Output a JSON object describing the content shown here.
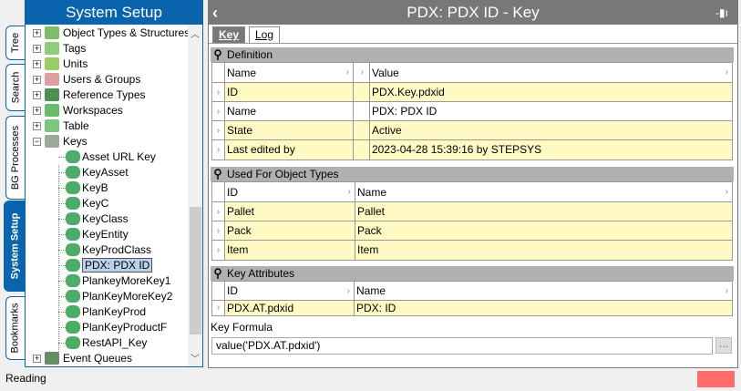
{
  "vertical_tabs": [
    "Tree",
    "Search",
    "BG Processes",
    "System Setup",
    "Bookmarks"
  ],
  "left_panel": {
    "title": "System Setup",
    "tree": [
      {
        "label": "Object Types & Structures",
        "level": 0,
        "expander": "+",
        "icon": "object-types-icon"
      },
      {
        "label": "Tags",
        "level": 0,
        "expander": "+",
        "icon": "tags-icon"
      },
      {
        "label": "Units",
        "level": 0,
        "expander": "+",
        "icon": "units-icon"
      },
      {
        "label": "Users & Groups",
        "level": 0,
        "expander": "+",
        "icon": "users-icon"
      },
      {
        "label": "Reference Types",
        "level": 0,
        "expander": "+",
        "icon": "reference-types-icon"
      },
      {
        "label": "Workspaces",
        "level": 0,
        "expander": "+",
        "icon": "workspaces-icon"
      },
      {
        "label": "Table",
        "level": 0,
        "expander": "+",
        "icon": "table-icon"
      },
      {
        "label": "Keys",
        "level": 0,
        "expander": "-",
        "icon": "keys-icon"
      },
      {
        "label": "Asset URL Key",
        "level": 1,
        "icon": "key-icon"
      },
      {
        "label": "KeyAsset",
        "level": 1,
        "icon": "key-icon"
      },
      {
        "label": "KeyB",
        "level": 1,
        "icon": "key-icon"
      },
      {
        "label": "KeyC",
        "level": 1,
        "icon": "key-icon"
      },
      {
        "label": "KeyClass",
        "level": 1,
        "icon": "key-icon"
      },
      {
        "label": "KeyEntity",
        "level": 1,
        "icon": "key-icon"
      },
      {
        "label": "KeyProdClass",
        "level": 1,
        "icon": "key-icon"
      },
      {
        "label": "PDX: PDX ID",
        "level": 1,
        "icon": "key-icon",
        "selected": true
      },
      {
        "label": "PlankeyMoreKey1",
        "level": 1,
        "icon": "key-icon"
      },
      {
        "label": "PlanKeyMoreKey2",
        "level": 1,
        "icon": "key-icon"
      },
      {
        "label": "PlanKeyProd",
        "level": 1,
        "icon": "key-icon"
      },
      {
        "label": "PlanKeyProductF",
        "level": 1,
        "icon": "key-icon"
      },
      {
        "label": "RestAPI_Key",
        "level": 1,
        "icon": "key-icon"
      },
      {
        "label": "Event Queues",
        "level": 0,
        "expander": "+",
        "icon": "event-queues-icon"
      }
    ]
  },
  "status": "Reading",
  "right_panel": {
    "title": "PDX: PDX ID - Key",
    "tabs": [
      "Key",
      "Log"
    ],
    "definition": {
      "title": "Definition",
      "headers": [
        "Name",
        "Value"
      ],
      "rows": [
        [
          "ID",
          "PDX.Key.pdxid"
        ],
        [
          "Name",
          "PDX: PDX ID"
        ],
        [
          "State",
          "Active"
        ],
        [
          "Last edited by",
          "2023-04-28 15:39:16 by STEPSYS"
        ]
      ]
    },
    "used_for": {
      "title": "Used For Object Types",
      "headers": [
        "ID",
        "Name"
      ],
      "rows": [
        [
          "Pallet",
          "Pallet"
        ],
        [
          "Pack",
          "Pack"
        ],
        [
          "Item",
          "Item"
        ]
      ]
    },
    "key_attributes": {
      "title": "Key Attributes",
      "headers": [
        "ID",
        "Name"
      ],
      "rows": [
        [
          "PDX.AT.pdxid",
          "PDX: ID"
        ]
      ]
    },
    "formula_label": "Key Formula",
    "formula_value": "value('PDX.AT.pdxid')",
    "formula_button": "..."
  },
  "colors": {
    "accent": "#0a64ad",
    "header_gray": "#787878",
    "row_yellow": "#fff9c4"
  }
}
